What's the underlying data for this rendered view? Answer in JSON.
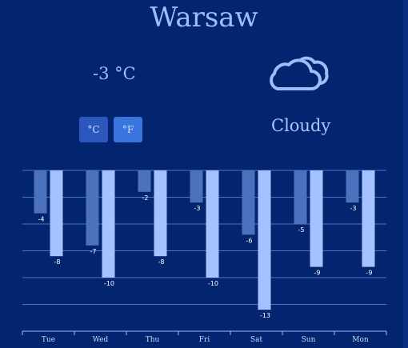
{
  "weather": {
    "city": "Warsaw",
    "temperature": "-3 °C",
    "condition": "Cloudy",
    "condition_icon": "cloud-icon",
    "units": {
      "celsius": "°C",
      "fahrenheit": "°F"
    }
  },
  "chart_data": {
    "type": "bar",
    "categories": [
      "Tue",
      "Wed",
      "Thu",
      "Fri",
      "Sat",
      "Sun",
      "Mon"
    ],
    "series": [
      {
        "values": [
          -4,
          -7,
          -2,
          -3,
          -6,
          -5,
          -3
        ],
        "color": "#4c72bd"
      },
      {
        "values": [
          -8,
          -10,
          -8,
          -10,
          -13,
          -9,
          -9
        ],
        "color": "#a4c2ff"
      }
    ],
    "ylim": [
      -15,
      0
    ],
    "grid": true
  },
  "colors": {
    "background": "#03246f",
    "button_c": "#2c57bc",
    "button_f": "#3a74de",
    "text": "#a9c6ff"
  }
}
